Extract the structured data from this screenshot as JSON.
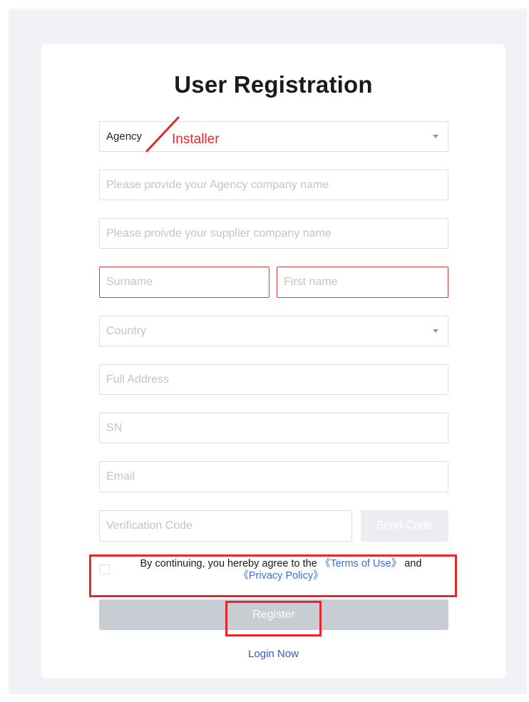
{
  "page": {
    "title": "User Registration"
  },
  "form": {
    "role_select": {
      "value": "Agency",
      "annotation": "Installer"
    },
    "agency_company": {
      "placeholder": "Please provide your Agency company name"
    },
    "supplier_company": {
      "placeholder": "Please proivde your supplier company name"
    },
    "surname": {
      "placeholder": "Surname"
    },
    "first_name": {
      "placeholder": "First name"
    },
    "country": {
      "placeholder": "Country"
    },
    "full_address": {
      "placeholder": "Full Address"
    },
    "sn": {
      "placeholder": "SN"
    },
    "email": {
      "placeholder": "Email"
    },
    "verification_code": {
      "placeholder": "Verification Code"
    },
    "send_code_label": "Send Code",
    "agreement": {
      "prefix": "By continuing, you hereby agree to the ",
      "terms_link": "《Terms of Use》",
      "middle": " and",
      "privacy_link": "《Privacy Policy》"
    },
    "register_label": "Register",
    "login_label": "Login Now"
  },
  "colors": {
    "annotation": "#e8262b",
    "link": "#3a6fd8",
    "error_border": "#e03b3b"
  }
}
